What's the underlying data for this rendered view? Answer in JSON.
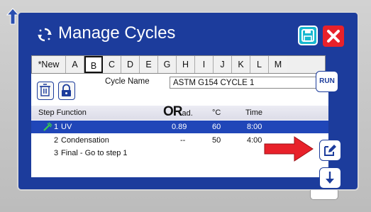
{
  "window": {
    "title": "Manage Cycles",
    "icons": {
      "title": "cycle-arrows-icon",
      "save": "save-icon",
      "close": "close-icon",
      "corner": "back-arrow-icon"
    }
  },
  "tabs": {
    "new_label": "*New",
    "letters": [
      "A",
      "B",
      "C",
      "D",
      "E",
      "G",
      "H",
      "I",
      "J",
      "K",
      "L",
      "M"
    ],
    "active": "B"
  },
  "panel": {
    "cycle_name_label": "Cycle Name",
    "cycle_name_value": "ASTM G154 CYCLE 1",
    "trash_icon": "trash-icon",
    "lock_icon": "lock-icon"
  },
  "table": {
    "headers": {
      "step_function": "Step Function",
      "irradiance_prefix": "OR",
      "irradiance_suffix": "ad.",
      "temperature": "°C",
      "time": "Time"
    },
    "rows": [
      {
        "step": "1",
        "function": "UV",
        "irradiance": "0.89",
        "temperature": "60",
        "time": "8:00",
        "selected": true,
        "icon": "light-icon"
      },
      {
        "step": "2",
        "function": "Condensation",
        "irradiance": "--",
        "temperature": "50",
        "time": "4:00",
        "selected": false
      },
      {
        "step": "3",
        "function": "Final - Go to step 1",
        "irradiance": "",
        "temperature": "",
        "time": "",
        "selected": false
      }
    ]
  },
  "side_buttons": {
    "run_label": "RUN",
    "edit_icon": "edit-icon",
    "down_icon": "arrow-down-icon"
  },
  "annotation": {
    "arrow_icon": "red-pointer-arrow-icon",
    "color": "#e8212a"
  },
  "colors": {
    "window_bg": "#1c3c9c",
    "selected_row": "#2046b8",
    "save_button": "#18b8d0",
    "close_button": "#e8212a"
  }
}
